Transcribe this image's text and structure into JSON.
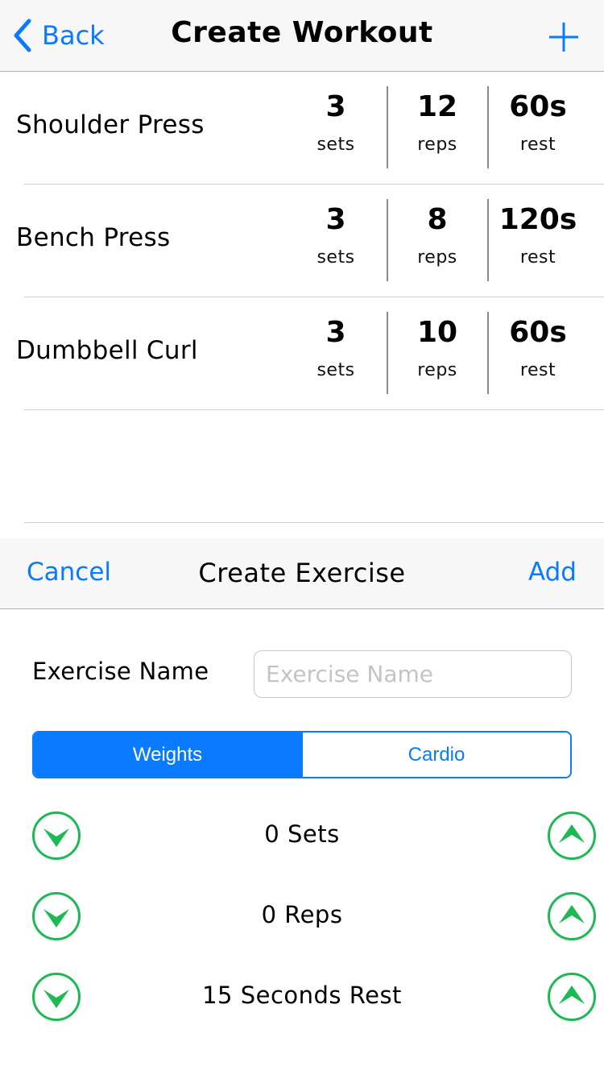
{
  "navbar": {
    "back_label": "Back",
    "title": "Create Workout",
    "add_icon": "plus-icon",
    "back_icon": "chevron-left-icon"
  },
  "exercises": [
    {
      "name": "Shoulder Press",
      "sets": "3",
      "sets_label": "sets",
      "reps": "12",
      "reps_label": "reps",
      "rest": "60s",
      "rest_label": "rest"
    },
    {
      "name": "Bench Press",
      "sets": "3",
      "sets_label": "sets",
      "reps": "8",
      "reps_label": "reps",
      "rest": "120s",
      "rest_label": "rest"
    },
    {
      "name": "Dumbbell Curl",
      "sets": "3",
      "sets_label": "sets",
      "reps": "10",
      "reps_label": "reps",
      "rest": "60s",
      "rest_label": "rest"
    }
  ],
  "sheet": {
    "cancel_label": "Cancel",
    "title": "Create Exercise",
    "add_label": "Add",
    "name_label": "Exercise Name",
    "name_value": "",
    "name_placeholder": "Exercise Name",
    "segments": [
      "Weights",
      "Cardio"
    ],
    "selected_segment": "Weights",
    "steppers": [
      {
        "label": "0 Sets"
      },
      {
        "label": "0 Reps"
      },
      {
        "label": "15 Seconds Rest"
      }
    ]
  },
  "colors": {
    "accent": "#0a7aff",
    "stepper": "#1db954",
    "bar_background": "#f7f7f7"
  }
}
